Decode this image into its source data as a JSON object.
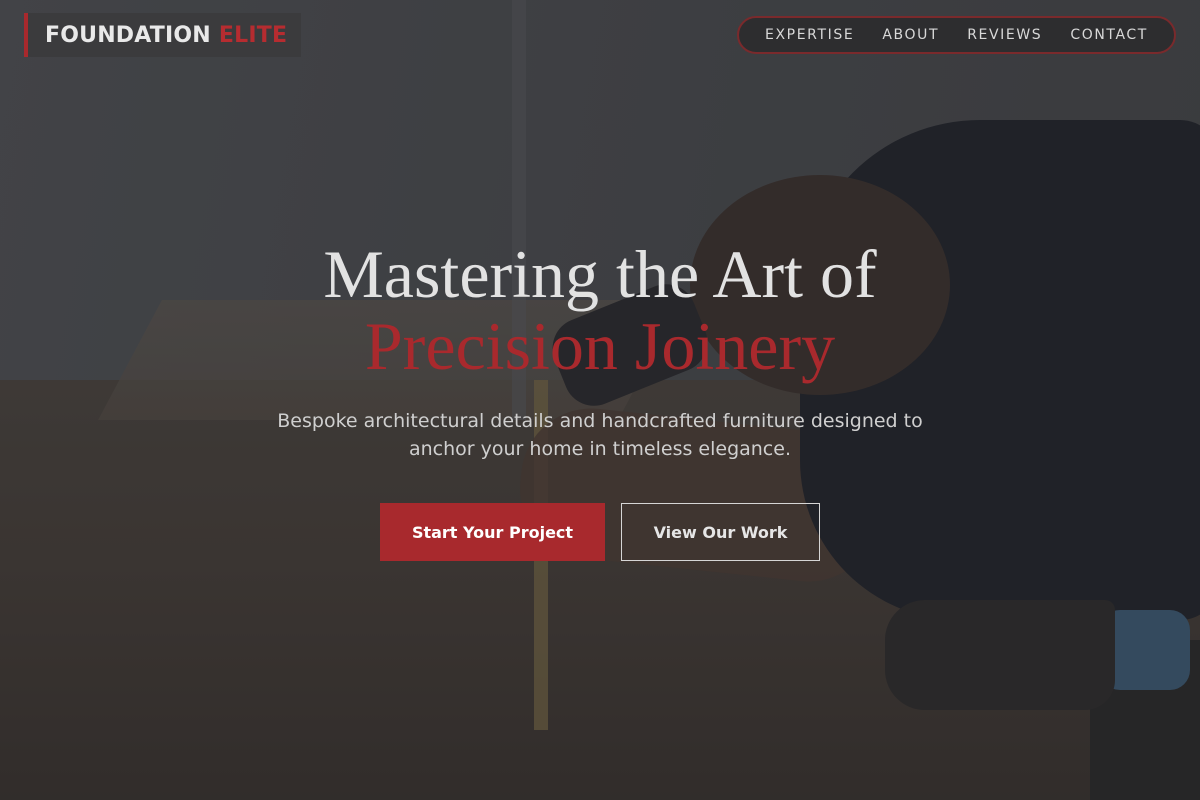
{
  "brand": {
    "name_part1": "FOUNDATION",
    "name_part2": "ELITE",
    "accent_color": "#a8292d"
  },
  "nav": {
    "items": [
      {
        "label": "EXPERTISE"
      },
      {
        "label": "ABOUT"
      },
      {
        "label": "REVIEWS"
      },
      {
        "label": "CONTACT"
      }
    ]
  },
  "hero": {
    "headline_line1": "Mastering the Art of",
    "headline_line2": "Precision Joinery",
    "subtitle": "Bespoke architectural details and handcrafted furniture designed to anchor your home in timeless elegance.",
    "primary_cta": "Start Your Project",
    "secondary_cta": "View Our Work"
  }
}
